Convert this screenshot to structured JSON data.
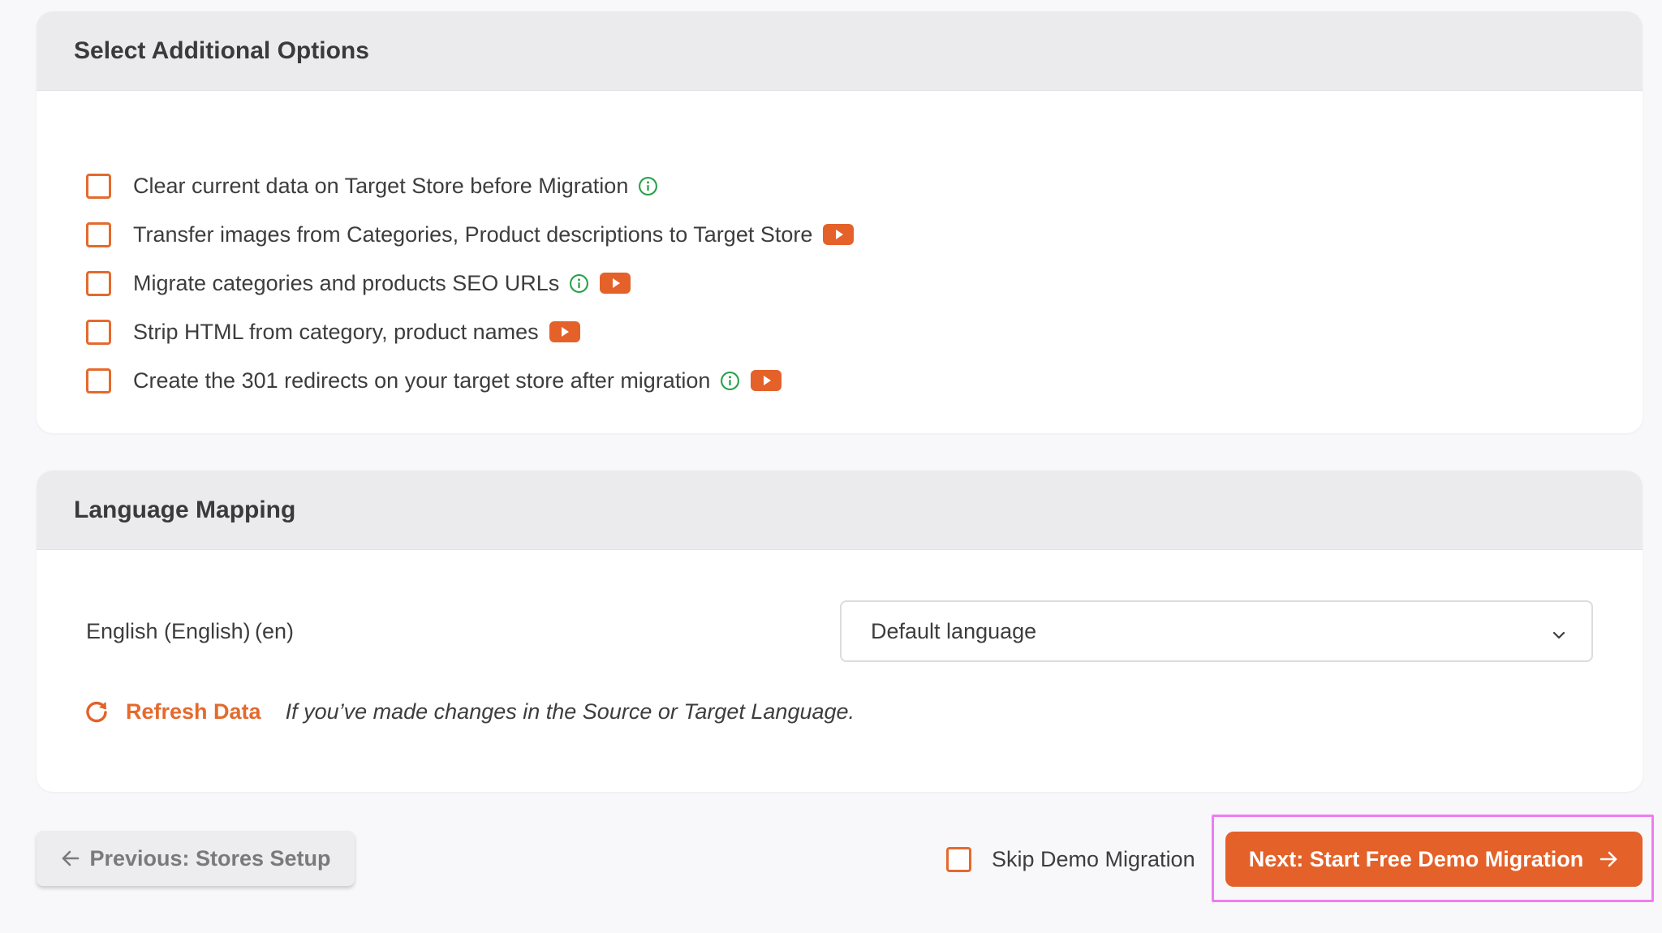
{
  "colors": {
    "accent": "#e4612a",
    "info_green": "#27a04a",
    "header_bg": "#ebebee",
    "highlight": "#ef7cf2"
  },
  "options_section": {
    "title": "Select Additional Options",
    "items": [
      {
        "label": "Clear current data on Target Store before Migration",
        "checked": false,
        "icons": [
          "info-icon"
        ]
      },
      {
        "label": "Transfer images from Categories, Product descriptions to Target Store",
        "checked": false,
        "icons": [
          "youtube-icon"
        ]
      },
      {
        "label": "Migrate categories and products SEO URLs",
        "checked": false,
        "icons": [
          "info-icon",
          "youtube-icon"
        ]
      },
      {
        "label": "Strip HTML from category, product names",
        "checked": false,
        "icons": [
          "youtube-icon"
        ]
      },
      {
        "label": "Create the 301 redirects on your target store after migration",
        "checked": false,
        "icons": [
          "info-icon",
          "youtube-icon"
        ]
      }
    ]
  },
  "language_section": {
    "title": "Language Mapping",
    "source_language": "English (English) (en)",
    "target_select": {
      "selected": "Default language"
    },
    "refresh": {
      "label": "Refresh Data",
      "note": "If you’ve made changes in the Source or Target Language."
    }
  },
  "footer": {
    "prev_label": "Previous: Stores Setup",
    "skip_label": "Skip Demo Migration",
    "skip_checked": false,
    "next_label": "Next: Start Free Demo Migration"
  }
}
